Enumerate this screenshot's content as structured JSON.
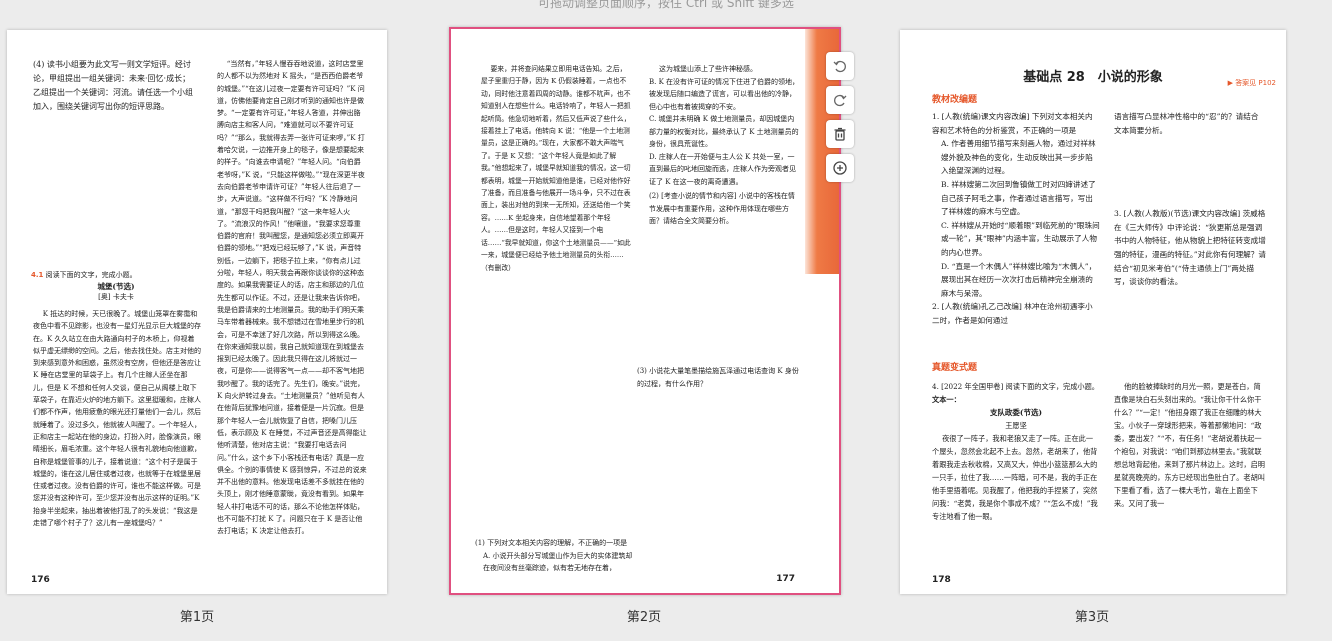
{
  "hint": "可拖动调整页面顺序，按住 Ctrl 或 Shift 键多选",
  "page_labels": [
    "第1页",
    "第2页",
    "第3页"
  ],
  "toolbar": {
    "icons": [
      "rotate-left-icon",
      "rotate-right-icon",
      "delete-icon",
      "add-icon"
    ]
  },
  "page1": {
    "number": "176",
    "left_top": "(4) 读书小组要为此文写一则文学短评。经讨论，甲组提出一组关键词：未来·回忆·成长；乙组提出一个关键词：河流。请任选一个小组加入，围绕关键词写出你的短评思路。",
    "task_num": "4.1",
    "task_head": "阅读下面的文字，完成小题。",
    "title": "城堡(节选)",
    "author": "[奥] 卡夫卡",
    "left_body": "K 抵达的时候，天已很晚了。城堡山笼罩在雾霭和夜色中看不见踪影，也没有一星灯光显示巨大城堡的存在。K 久久站立在由大路通向村子的木桥上，仰视着似乎虚无缥缈的空间。之后，他去找住处。店主对他的到来感到意外和困惑，虽然没有空房，但他还是答应让 K 睡在店堂里的草袋子上。有几个庄稼人还坐在那儿，但是 K 不想和任何人交谈，便自己从阁楼上取下草袋子，在靠近火炉的地方躺下。这里挺暖和，庄稼人们都不作声，他用疲惫的眼光还打量他们一会儿，然后就睡着了。没过多久，他就被人叫醒了。一个年轻人，正和店主一起站在他的身边，打扮入时，脸像演员，眼睛细长，眉毛浓重。这个年轻人很有礼貌地向他道歉，自称是城堡管事的儿子，接着说道：“这个村子是属于城堡的，谁在这儿居住或者过夜，也就等于在城堡里居住或者过夜。没有伯爵的许可，谁也不能这样做。可是您并没有这种许可，至少您并没有出示这样的证明。”K 抬身半坐起来，抽出着被他打乱了的头发说：“我这是走错了哪个村子了？这儿有一座城堡吗？”",
    "right_body": "“当然有，”年轻人慢吞吞地说道，这时店堂里的人都不以为然地对 K 摇头，“是西西伯爵老爷的城堡。”“在这儿过夜一定要有许可证吗？”K 问道，仿佛他要肯定自己刚才听到的通知也许是做梦。“一定要有许可证，”年轻人答道，并伸出胳膊向店主和客人问，“难道就可以不要许可证吗？”“那么，我就得去弄一张许可证来啰，”K 打着哈欠说，一边推开身上的毯子，像是想要起来的样子。“向谁去申请呢？”年轻人问。“向伯爵老爷呀，”K 说，“只能这样做啦。”“现在深更半夜去向伯爵老爷申请许可证？”年轻人往后退了一步，大声说道。“这样做不行吗？”K 冷静地问道，“那您干吗把我叫醒？”这一来年轻人火了。“流浪汉的作风！”他嚷道，“我要求您尊重伯爵的官府！我叫醒您，是通知您必须立即离开伯爵的领地。”“把戏已经玩够了，”K 说，声音特别低，一边躺下，把毯子拉上来，“你有点儿过分啦，年轻人，明天我会再跟你谈谈你的这种态度的。如果我需要证人的话，店主和那边的几位先生都可以作证。不过，还是让我来告诉你吧，我是伯爵请来的土地测量员。我的助手们明天乘马车带着器械来。我不想错过在雪地里步行的机会，可是不幸迷了好几次路，所以到得这么晚。在你来通知我以前，我自己就知道现在到城堡去报到已经太晚了。因此我只得在这儿将就过一夜，可是你——说得客气一点——却不客气地把我吵醒了。我的话完了。先生们，晚安。”说完，K 向火炉转过身去。“土地测量员？”他听见有人在他背后犹豫地问道，接着便是一片沉寂。但是那个年轻人一会儿就恢复了自信，把嗓门儿压低，表示顾及 K 在睡觉，不过声音还是高得能让他听清楚，他对店主说：“我要打电话去问问。”什么，这个乡下小客栈还有电话？真是一应俱全。个别的事情使 K 感到惊异，不过总的说来并不出他的意料。他发现电话差不多就挂在他的头顶上，刚才他睡意蒙眬，竟没有看到。如果年轻人非打电话不可的话，那么不论他怎样体贴，也不可能不打扰 K 了。问题只在于 K 是否让他去打电话；K 决定让他去打。"
  },
  "page2": {
    "number": "177",
    "left_body": "要来，并将查问结果立即用电话告知。之后，屋子里重归于静，因为 K 仍假装睡着，一点也不动，同时他注意着四周的动静。谁都不吭声，也不知道别人在想些什么。电话铃响了，年轻人一把抓起听筒。他急切地听着，然后又低声说了些什么，接着挂上了电话。他转向 K 说：“他是一个土地测量员，这是正确的。”现在，大家都不敢大声喘气了。于是 K 又想：“这个年轻人竟是如此了解我。”他想起来了，城堡早就知道我的情况，这一切都表明，城堡一开始就知道他是谁，已经对他作好了准备，而且准备与他展开一场斗争，只不过在表面上，装出对他的到来一无所知，还送给他一个笑容。……K 坐起身来，自信地望着那个年轻人。……但是这时，年轻人又接到一个电话……“我早就知道，你这个土地测量员——”如此一来，城堡便已经给予他土地测量员的头衔……（有删改）",
    "q1_intro": "(1) 下列对文本相关内容的理解，不正确的一项是",
    "q1_optA": "A. 小说开头部分写城堡山作为巨大的实体建筑却在夜间没有丝毫踪迹，似有若无地存在着，",
    "right_cont": "这为城堡山添上了些许神秘感。",
    "right_optB": "B. K 在没有许可证的情况下住进了伯爵的领地，被发现后随口编造了谎言，可以看出他的冷静，但心中也有着被揭穿的不安。",
    "right_optC": "C. 城堡并未明确 K 做土地测量员，却因城堡内部力量的权衡对比，最终承认了 K 土地测量员的身份，很具荒诞性。",
    "right_optD": "D. 庄稼人在一开始便与主人公 K 共处一室，一直到最后的叱地回旋而逃，庄稼人作为旁观者见证了 K 在这一夜的离奇遭遇。",
    "q2": "(2) [考查小说的情节和内容] 小说中的客栈在情节发展中有重要作用，这种作用体现在哪些方面？请结合全文简要分析。",
    "q3": "(3) 小说花大量笔墨描绘施瓦泽通过电话查询 K 身份的过程，有什么作用？"
  },
  "page3": {
    "number": "178",
    "title": "基础点 28　小说的形象",
    "ans_ref": "答案见 P102",
    "section1": "教材改编题",
    "q1": "1. [人教(统编)课文内容改编] 下列对文本相关内容和艺术特色的分析鉴赏，不正确的一项是",
    "q1A": "A. 作者善用细节描写来刻画人物，通过对祥林嫂外貌及神色的变化，生动反映出其一步步陷入绝望深渊的过程。",
    "q1B": "B. 祥林嫂第二次回到鲁镇做工时对四婶讲述了自己孩子阿毛之事，作者通过语言描写，写出了祥林嫂的麻木与空虚。",
    "q1C": "C. 祥林嫂从开始时“顺着眼”到临死前的“眼珠间或一轮”，其“眼神”内涵丰富，生动展示了人物的内心世界。",
    "q1D": "D. “直是一个木偶人”祥林嫂比喻为“木偶人”，展现出其在经历一次次打击后精神完全崩溃的麻木与呆滞。",
    "q2": "2. [人教(统编)孔乙己改编] 林冲在沧州初遇李小二时，作者是如何通过",
    "q2_right": "语言描写凸显林冲性格中的“忍”的？请结合文本简要分析。",
    "q3": "3. [人教(人教版)(节选)课文内容改编] 茨威格在《三大师传》中评论说：“狄更斯总是强调书中的人物特征，他从物貌上把特征转变成增强的特征，漫画的特征。”对此你有何理解？请结合“初见米考伯”(“侍主通债上门”两处描写，谈谈你的看法。",
    "section2": "真题变式题",
    "q4": "4. [2022 年全国甲卷] 阅读下面的文字，完成小题。",
    "text1": "文本一：",
    "story_title": "支队政委(节选)",
    "story_author": "王愿坚",
    "story_body": "夜很了一阵子，我和老狼又走了一阵。正在此一个屋头，忽然会北起不上去。忽然，老胡来了，他背着跟我走去秋收棉，又高又大，仲出小篮篮那么大的一只手，拉住了我……一阵暗，可不是，我的手正在他手里捂着呢。见我醒了，他把我的手捏紧了，突然问我：“老黄，我是你个事成不成？”“怎么不成！”我专注地看了他一眼。",
    "story_right": "他的脸被捧缺时的月光一照，更是苍白，简直像是块白石头刻出来的。“我让你干什么你干什么？”“一定！”他扭身跟了我正在细雕的林大宝。小伙子一穿球形把来，等着那懒地问：“政委，要出发？”“不，有任务！”老胡说着扶起一个袍包，对我说：“咱们到那边林里去。”我就联想总地背起他，来到了那片林边上。这时，启明星就亮晚亮的，东方已经现出鱼肚白了。老胡叫下里看了看，选了一棵大毛竹，靠在上面坐下来。又问了我一"
  }
}
